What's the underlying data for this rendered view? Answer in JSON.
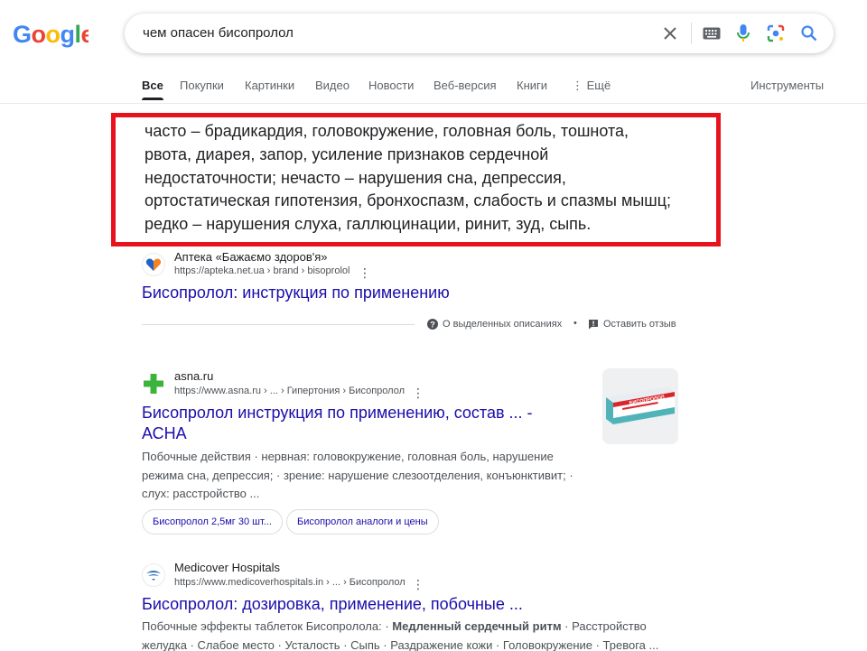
{
  "logo": {
    "text": "Google"
  },
  "search": {
    "query": "чем опасен бисопролол",
    "icons": [
      "close-icon",
      "keyboard-icon",
      "mic-icon",
      "lens-icon",
      "search-icon"
    ]
  },
  "tabs": [
    {
      "label": "Все",
      "active": true
    },
    {
      "label": "Покупки"
    },
    {
      "label": "Картинки"
    },
    {
      "label": "Видео"
    },
    {
      "label": "Новости"
    },
    {
      "label": "Веб-версия"
    },
    {
      "label": "Книги"
    },
    {
      "label": "Ещё"
    }
  ],
  "tools_label": "Инструменты",
  "highlight_color": "#e8121c",
  "snippet": {
    "lines": [
      "часто – брадикардия, головокружение, головная боль, тошнота,",
      "рвота, диарея, запор, усиление признаков сердечной",
      "недостаточности; нечасто – нарушения сна, депрессия,",
      "ортостатическая гипотензия, бронхоспазм, слабость и спазмы мышц;",
      "редко – нарушения слуха, галлюцинации, ринит, зуд, сыпь."
    ]
  },
  "results": [
    {
      "site": "Аптека «Бажаємо здоров'я»",
      "url": "https://apteka.net.ua › brand › bisoprolol",
      "title": "Бисопролол: инструкция по применению",
      "meta_about": "О выделенных описаниях",
      "meta_feedback": "Оставить отзыв"
    },
    {
      "site": "asna.ru",
      "url": "https://www.asna.ru › ... › Гипертония › Бисопролол",
      "title_line1": "Бисопролол инструкция по применению, состав ... -",
      "title_line2": "АСНА",
      "desc_line1": "Побочные действия · нервная: головокружение, головная боль, нарушение",
      "desc_line2": "режима сна, депрессия; · зрение: нарушение слезоотделения, конъюнктивит; ·",
      "desc_line3": "слух: расстройство ...",
      "chips": [
        "Бисопролол 2,5мг 30 шт...",
        "Бисопролол аналоги и цены"
      ],
      "thumb_label": "БИСОПРОЛОЛ"
    },
    {
      "site": "Medicover Hospitals",
      "url": "https://www.medicoverhospitals.in › ... › Бисопролол",
      "title": "Бисопролол: дозировка, применение, побочные ...",
      "desc_line1_pre": "Побочные эффекты таблеток Бисопролола: · ",
      "desc_line1_bold": "Медленный сердечный ритм",
      "desc_line1_post": " · Расстройство",
      "desc_line2": "желудка · Слабое место · Усталость · Сыпь · Раздражение кожи · Головокружение · Тревога ..."
    }
  ]
}
